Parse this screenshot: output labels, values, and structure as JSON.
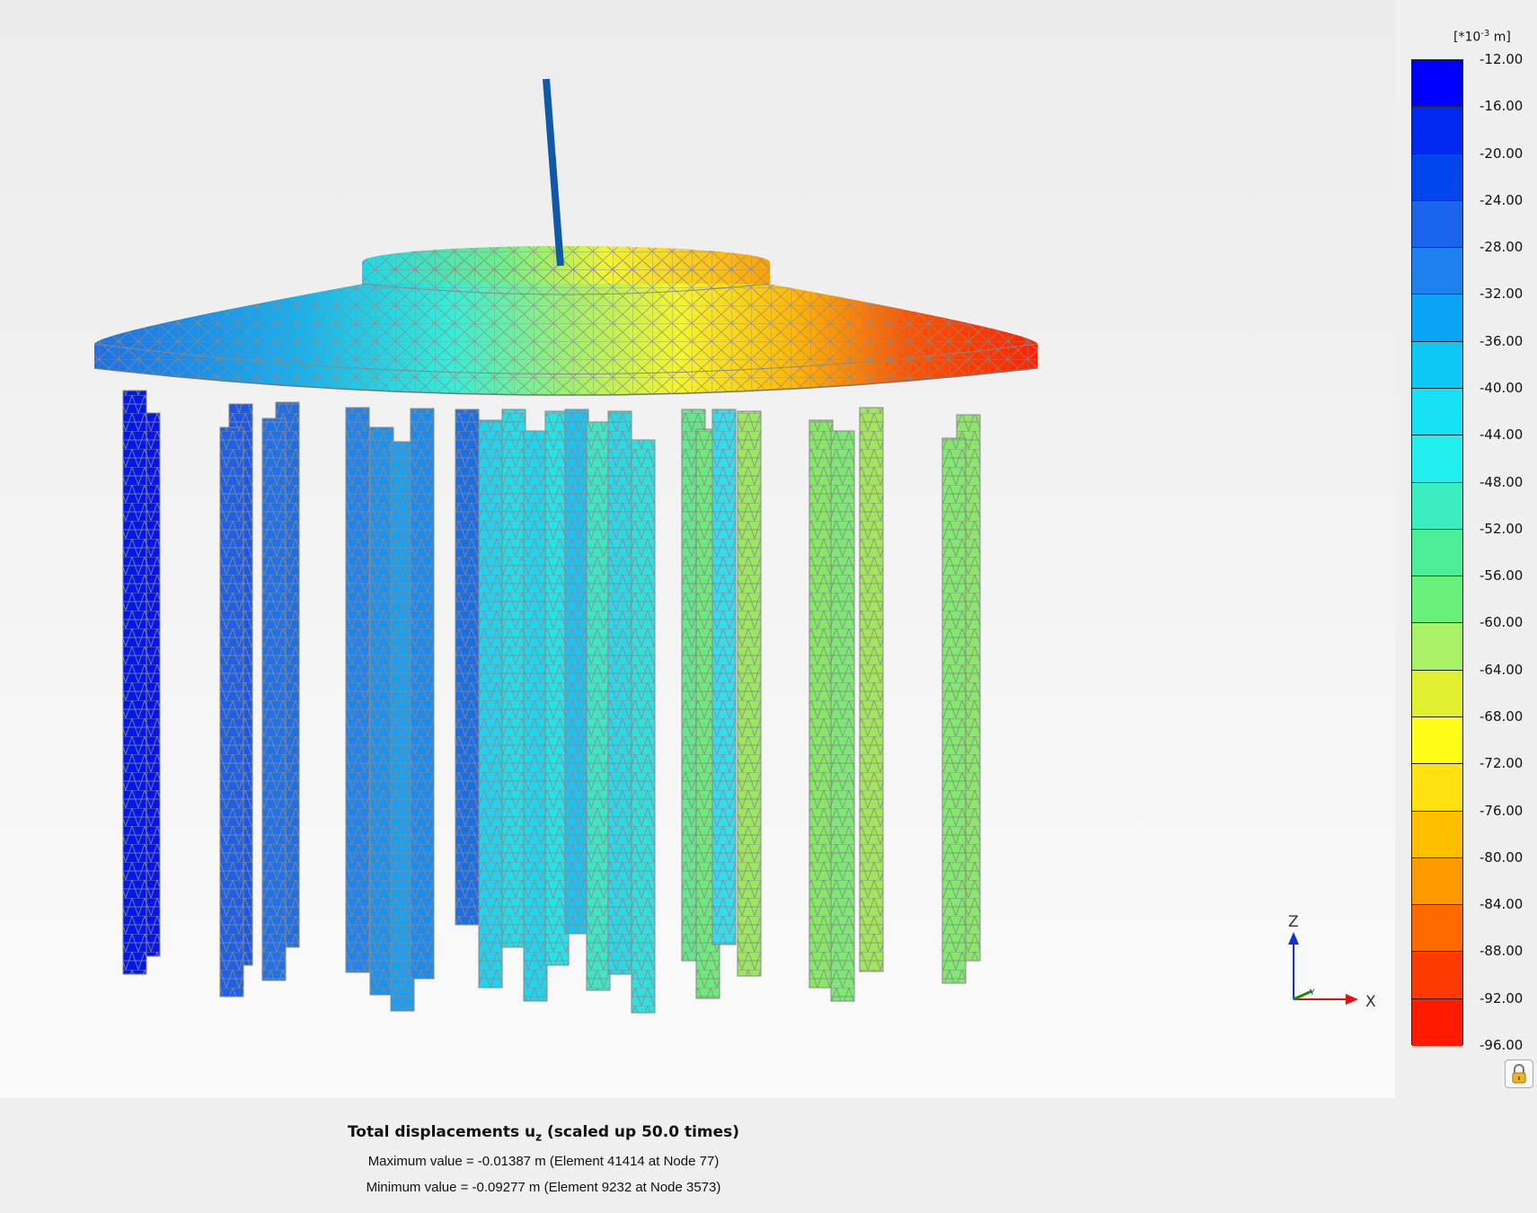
{
  "legend": {
    "unit_prefix": "[*10",
    "unit_exponent": "-3",
    "unit_suffix": " m]",
    "ticks": [
      "-12.00",
      "-16.00",
      "-20.00",
      "-24.00",
      "-28.00",
      "-32.00",
      "-36.00",
      "-40.00",
      "-44.00",
      "-48.00",
      "-52.00",
      "-56.00",
      "-60.00",
      "-64.00",
      "-68.00",
      "-72.00",
      "-76.00",
      "-80.00",
      "-84.00",
      "-88.00",
      "-92.00",
      "-96.00"
    ],
    "colors": [
      "#0000ff",
      "#0028ee",
      "#0046ee",
      "#1a63ec",
      "#1d80ee",
      "#0aa4f4",
      "#0bc8f5",
      "#15e3f5",
      "#22f0ee",
      "#3aeec0",
      "#4cee98",
      "#68f07a",
      "#a8f065",
      "#e0f030",
      "#ffff1a",
      "#ffe010",
      "#ffbe00",
      "#ff9900",
      "#ff6a00",
      "#ff3a00",
      "#ff1a00"
    ],
    "lock_icon": "lock-icon"
  },
  "axes": {
    "z": "Z",
    "y": "Y",
    "x": "X"
  },
  "caption": {
    "title_main": "Total displacements u",
    "title_sub": "z",
    "title_tail": " (scaled up 50.0 times)",
    "max_line": "Maximum value = -0.01387 m (Element 41414 at Node 77)",
    "min_line": "Minimum value = -0.09277 m (Element 9232 at Node 3573)"
  }
}
